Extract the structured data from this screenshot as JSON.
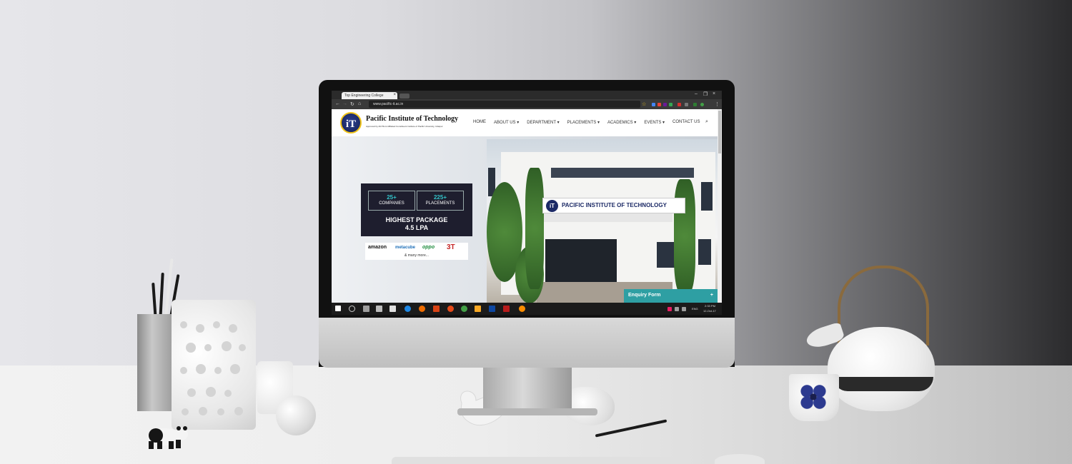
{
  "browser": {
    "tab_title": "Top Engineering College",
    "tab_close": "×",
    "url": "www.pacific-it.ac.in",
    "win_min": "–",
    "win_max": "❐",
    "win_close": "×"
  },
  "site": {
    "logo_letters": "iT",
    "logo_name": "Pacific Institute of Technology",
    "logo_tagline": "Approved by AICTE & Affiliated Constituent Institute of Pacific University, Udaipur",
    "menu": [
      "HOME",
      "ABOUT US ▾",
      "DEPARTMENT ▾",
      "PLACEMENTS ▾",
      "ACADEMICS ▾",
      "EVENTS ▾",
      "CONTACT US"
    ],
    "stats": [
      {
        "num": "25+",
        "label": "COMPANIES"
      },
      {
        "num": "225+",
        "label": "PLACEMENTS"
      }
    ],
    "highest_title": "HIGHEST PACKAGE",
    "highest_value": "4.5 LPA",
    "recruiters": [
      "amazon",
      "metacube",
      "oppo",
      "3T"
    ],
    "recruiters_more": "& many more...",
    "sign_text": "PACIFIC INSTITUTE OF TECHNOLOGY",
    "enquiry": "Enquiry Form",
    "enquiry_plus": "+"
  },
  "taskbar": {
    "lang": "ENG",
    "time": "2:33 PM",
    "date": "12-Oct-17"
  },
  "colors": {
    "accent_teal": "#33c4c9",
    "enquiry_bg": "#2e9fa3",
    "logo_navy": "#1c2a66",
    "stats_bg": "#1e1e2e"
  }
}
